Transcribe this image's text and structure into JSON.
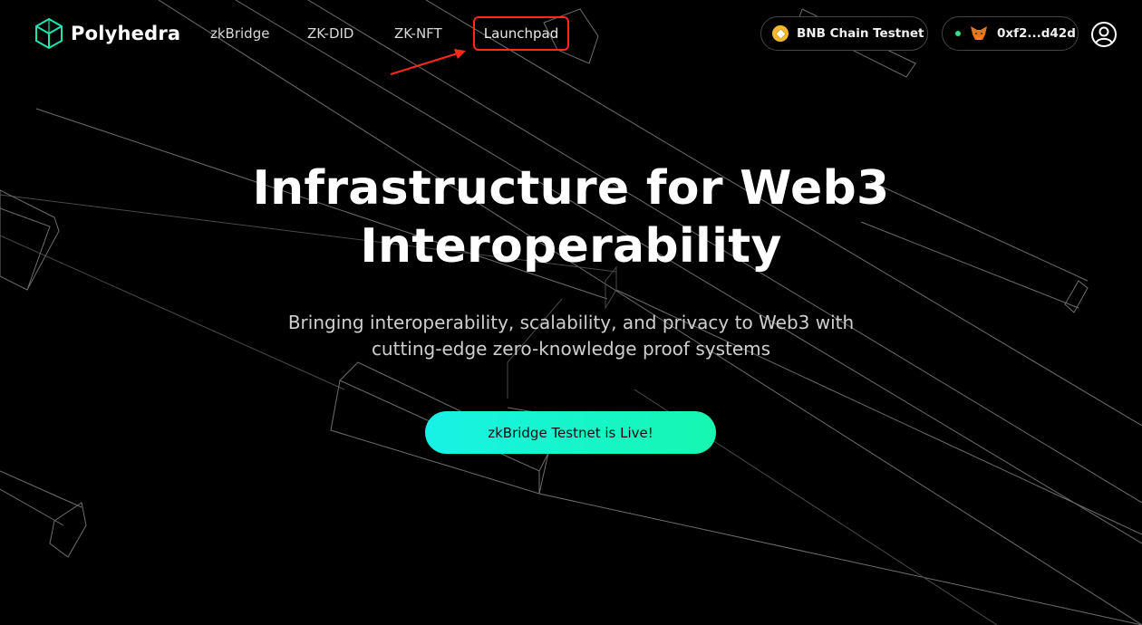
{
  "brand": {
    "name": "Polyhedra",
    "logo_icon": "polyhedron-logo-icon",
    "accent": "#20e3b2"
  },
  "nav": {
    "items": [
      {
        "label": "zkBridge"
      },
      {
        "label": "ZK-DID"
      },
      {
        "label": "ZK-NFT"
      },
      {
        "label": "Launchpad",
        "highlighted": true,
        "highlight_color": "#ff2a1a"
      }
    ]
  },
  "network": {
    "label": "BNB Chain Testnet",
    "icon": "bnb-coin-icon"
  },
  "wallet": {
    "address": "0xf2...d42d",
    "icon": "metamask-fox-icon",
    "status_color": "#2de28b"
  },
  "profile": {
    "icon": "user-profile-icon"
  },
  "hero": {
    "title_line1": "Infrastructure for Web3",
    "title_line2": "Interoperability",
    "subtitle_line1": "Bringing interoperability, scalability, and privacy to Web3 with",
    "subtitle_line2": "cutting-edge zero-knowledge proof systems",
    "cta_label": "zkBridge Testnet is Live!",
    "cta_gradient": [
      "#18f2e6",
      "#16f7b0"
    ]
  }
}
